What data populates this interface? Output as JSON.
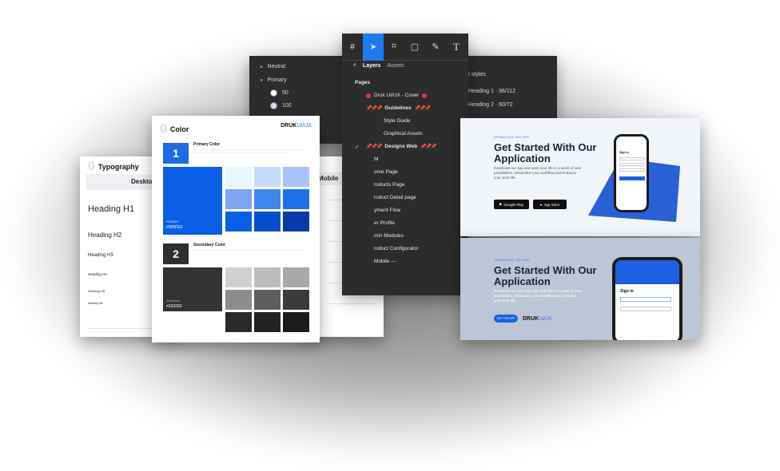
{
  "color_styles_panel": {
    "groups": [
      "Neutral",
      "Primary"
    ],
    "swatches": [
      {
        "label": "50",
        "color": "#ffffff"
      },
      {
        "label": "100",
        "color": "#cfe0ff"
      }
    ]
  },
  "text_styles_panel": {
    "header": "t styles",
    "items": [
      "Heading 1 · 96/112",
      "Heading 2 · 60/72"
    ]
  },
  "figma": {
    "tabs": [
      "Layers",
      "Assets"
    ],
    "pages_label": "Pages",
    "items": [
      {
        "label": "Druk UI/UX - Cover",
        "marker": "dots"
      },
      {
        "label": "Guidelines",
        "marker": "pins"
      },
      {
        "label": "Style Guide",
        "marker": "none"
      },
      {
        "label": "Graphical Assets",
        "marker": "none"
      },
      {
        "label": "Designs Web",
        "marker": "pins-check"
      },
      {
        "label": "M",
        "marker": "none"
      },
      {
        "label": "ome Page",
        "marker": "none"
      },
      {
        "label": "roducts Page",
        "marker": "none"
      },
      {
        "label": "roduct Detail page",
        "marker": "none"
      },
      {
        "label": "yment Flow",
        "marker": "none"
      },
      {
        "label": "er Profile",
        "marker": "none"
      },
      {
        "label": "min Modules",
        "marker": "none"
      },
      {
        "label": "roduct Configurator",
        "marker": "none"
      },
      {
        "label": "Mobile ---",
        "marker": "none"
      }
    ],
    "accent": "#1f7af0"
  },
  "typography_page": {
    "zero": "0",
    "title": "Typography",
    "section": "Deskto",
    "headings": [
      "Heading H1",
      "Heading H2",
      "Heading H3",
      "Heading H4",
      "Heading H5",
      "Heading H6"
    ]
  },
  "mobile_page": {
    "section": "Mobile"
  },
  "color_page": {
    "zero": "0",
    "title": "Color",
    "logo_main": "DRUK",
    "logo_sub": "UI/UX",
    "primary": {
      "number": "1",
      "heading": "Primary Color",
      "main_label": "PRIMARY",
      "main_hex": "#005FE5",
      "main_color": "#0a5fe5",
      "swatches": [
        "#e8f6ff",
        "#c7d9fb",
        "#a8c4fa",
        "#7fa6f2",
        "#3f86ee",
        "#1f6fe9",
        "#0a5fe5",
        "#0450cc",
        "#0a3aa8"
      ]
    },
    "secondary": {
      "number": "2",
      "heading": "Secondary Color",
      "main_label": "Secondary",
      "main_hex": "#333333",
      "main_color": "#333333",
      "swatches": [
        "#cfcfcf",
        "#bdbdbd",
        "#a8a8a8",
        "#8c8c8c",
        "#5e5e5e",
        "#3b3b3b",
        "#2a2a2a",
        "#222222",
        "#1b1b1b"
      ]
    }
  },
  "app_card_1": {
    "kicker": "DOWNLOAD THE APP",
    "title_line1": "Get Started With Our",
    "title_line2": "Application",
    "desc": "Download our App and open your life to a world of new possibilities. Streamline your workflow and enhance your work life.",
    "google_play": "Google Play",
    "app_store": "App Store",
    "phone_sign_in": "Sign in"
  },
  "app_card_2": {
    "kicker": "DOWNLOAD THE APP",
    "title_line1": "Get Started With Our",
    "title_line2": "Application",
    "desc": "Download our App and open your life to a world of new possibilities. Streamline your workflow and enhance your work life.",
    "button": "GET THE APP",
    "logo_main": "DRUK",
    "logo_sub": "UI/UX",
    "phone_sign_in": "Sign in"
  }
}
